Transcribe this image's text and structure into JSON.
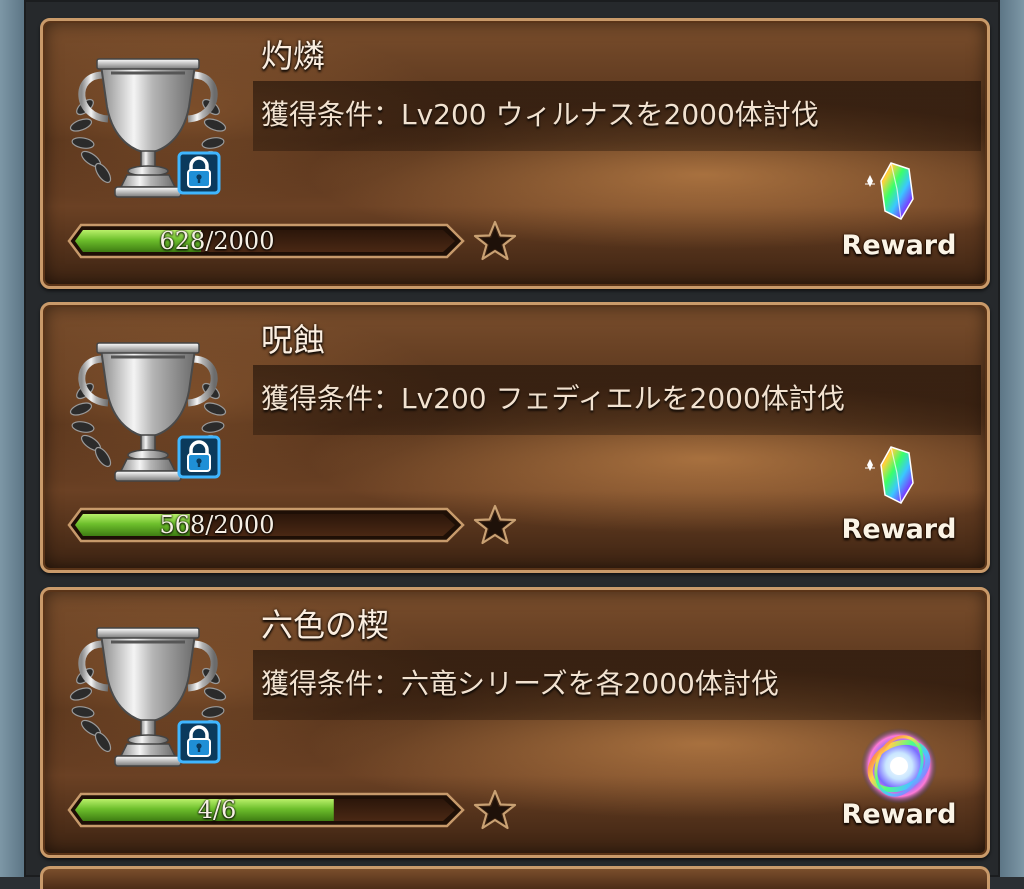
{
  "reward_label": "Reward",
  "colors": {
    "bar_fill": "#6dbf2c",
    "lock_blue": "#1f8fd6",
    "card_border": "#c99a6a"
  },
  "trophies": [
    {
      "title": "灼燐",
      "condition": "獲得条件：Lv200 ウィルナスを2000体討伐",
      "progress_text": "628/2000",
      "progress_fraction": 0.314,
      "reward_icon": "rainbow-crystal-icon",
      "locked": true
    },
    {
      "title": "呪蝕",
      "condition": "獲得条件：Lv200 フェディエルを2000体討伐",
      "progress_text": "568/2000",
      "progress_fraction": 0.284,
      "reward_icon": "rainbow-crystal-icon",
      "locked": true
    },
    {
      "title": "六色の楔",
      "condition": "獲得条件：六竜シリーズを各2000体討伐",
      "progress_text": "4/6",
      "progress_fraction": 0.667,
      "reward_icon": "prism-orb-icon",
      "locked": true
    }
  ]
}
